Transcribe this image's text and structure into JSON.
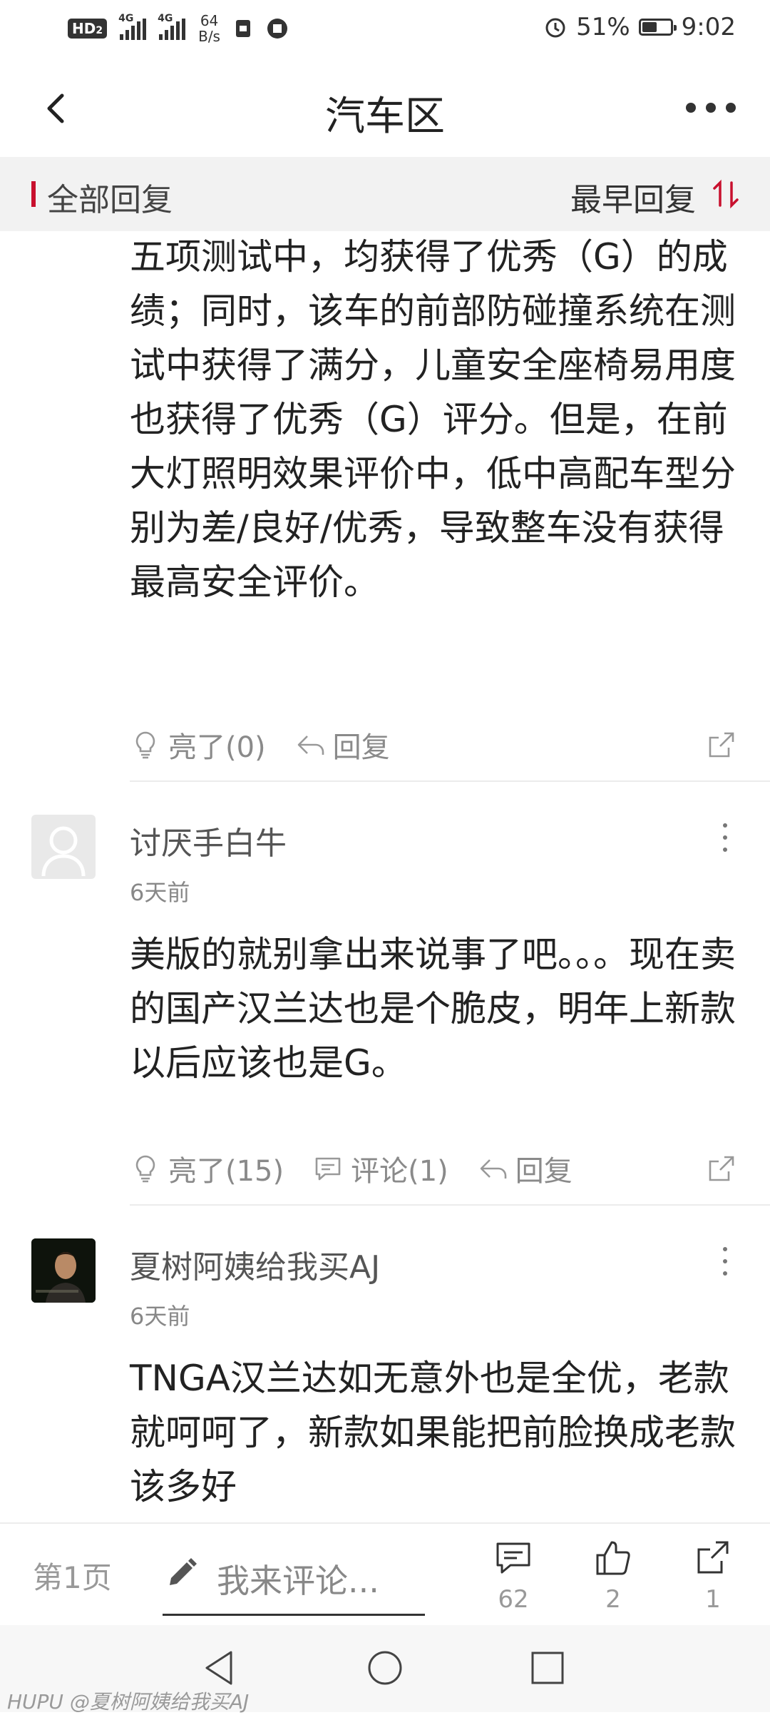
{
  "status_bar": {
    "hd_badge": "HD",
    "hd_sub": "2",
    "signal1_label": "4G",
    "signal2_label": "4G",
    "speed_value": "64",
    "speed_unit": "B/s",
    "battery_percent": "51%",
    "battery_level": 0.51,
    "time": "9:02"
  },
  "header": {
    "title": "汽车区"
  },
  "sort_bar": {
    "filter_label": "全部回复",
    "order_label": "最早回复",
    "accent_color": "#c8102e"
  },
  "posts": [
    {
      "continued_text": "五项测试中，均获得了优秀（G）的成绩；同时，该车的前部防碰撞系统在测试中获得了满分，儿童安全座椅易用度也获得了优秀（G）评分。但是，在前大灯照明效果评价中，低中高配车型分别为差/良好/优秀，导致整车没有获得最高安全评价。",
      "like_label": "亮了(0)",
      "reply_label": "回复"
    },
    {
      "username": "讨厌手白牛",
      "time": "6天前",
      "content": "美版的就别拿出来说事了吧。。。现在卖的国产汉兰达也是个脆皮，明年上新款以后应该也是G。",
      "like_label": "亮了(15)",
      "comment_label": "评论(1)",
      "reply_label": "回复"
    },
    {
      "username": "夏树阿姨给我买AJ",
      "time": "6天前",
      "content": "TNGA汉兰达如无意外也是全优，老款就呵呵了，新款如果能把前脸换成老款该多好"
    }
  ],
  "bottom_bar": {
    "page_label": "第1页",
    "comment_placeholder": "我来评论...",
    "comments_count": "62",
    "likes_count": "2",
    "shares_count": "1"
  },
  "watermark": "HUPU @夏树阿姨给我买AJ"
}
